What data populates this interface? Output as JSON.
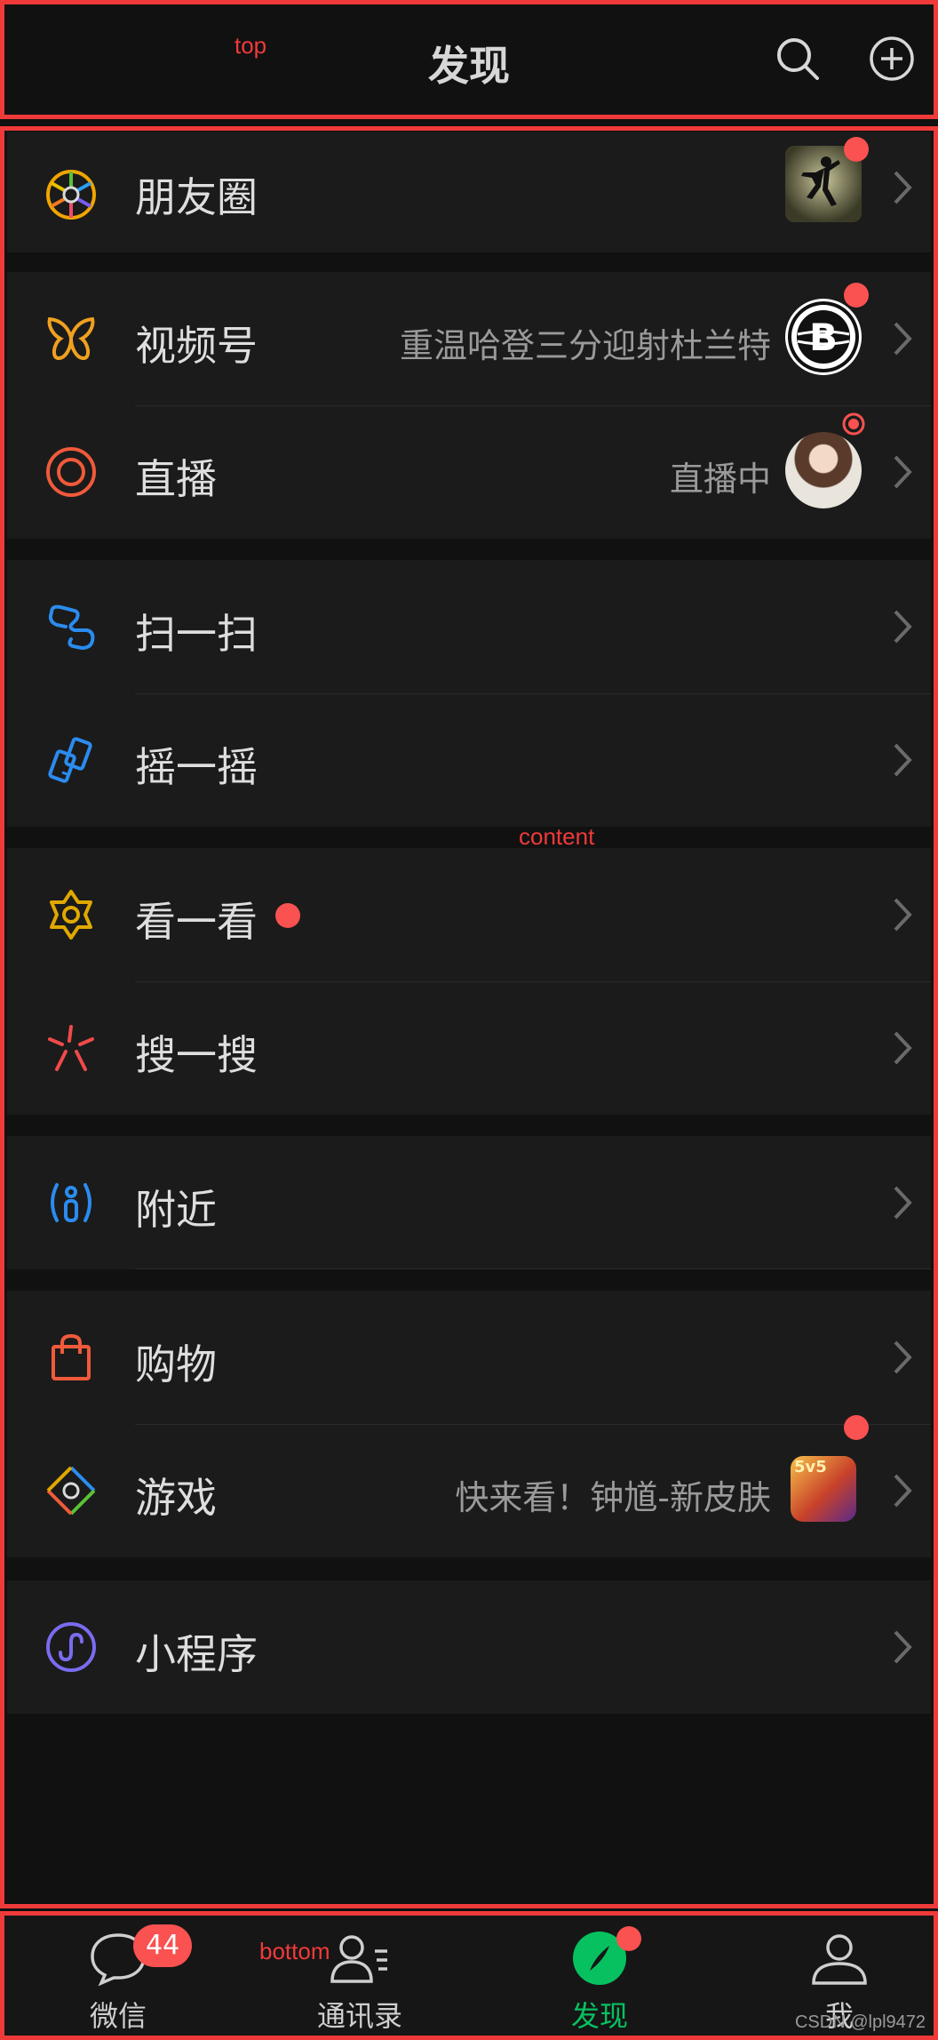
{
  "annotations": {
    "top": "top",
    "content": "content",
    "bottom": "bottom"
  },
  "header": {
    "title": "发现"
  },
  "groups": [
    {
      "items": [
        {
          "label": "朋友圈"
        }
      ]
    },
    {
      "items": [
        {
          "label": "视频号",
          "sub": "重温哈登三分迎射杜兰特"
        },
        {
          "label": "直播",
          "sub": "直播中"
        }
      ]
    },
    {
      "items": [
        {
          "label": "扫一扫"
        },
        {
          "label": "摇一摇"
        }
      ]
    },
    {
      "items": [
        {
          "label": "看一看"
        },
        {
          "label": "搜一搜"
        }
      ]
    },
    {
      "items": [
        {
          "label": "附近"
        }
      ]
    },
    {
      "items": [
        {
          "label": "购物"
        },
        {
          "label": "游戏",
          "sub": "快来看！钟馗-新皮肤"
        }
      ]
    },
    {
      "items": [
        {
          "label": "小程序"
        }
      ]
    }
  ],
  "thumb_texts": {
    "nets": "B",
    "game": "5v5"
  },
  "tabs": [
    {
      "label": "微信",
      "badge": "44"
    },
    {
      "label": "通讯录"
    },
    {
      "label": "发现"
    },
    {
      "label": "我"
    }
  ],
  "watermark": "CSDN @lpl9472",
  "colors": {
    "accent": "#07c160",
    "badge": "#fa5151",
    "annotation": "#f03a3a"
  }
}
